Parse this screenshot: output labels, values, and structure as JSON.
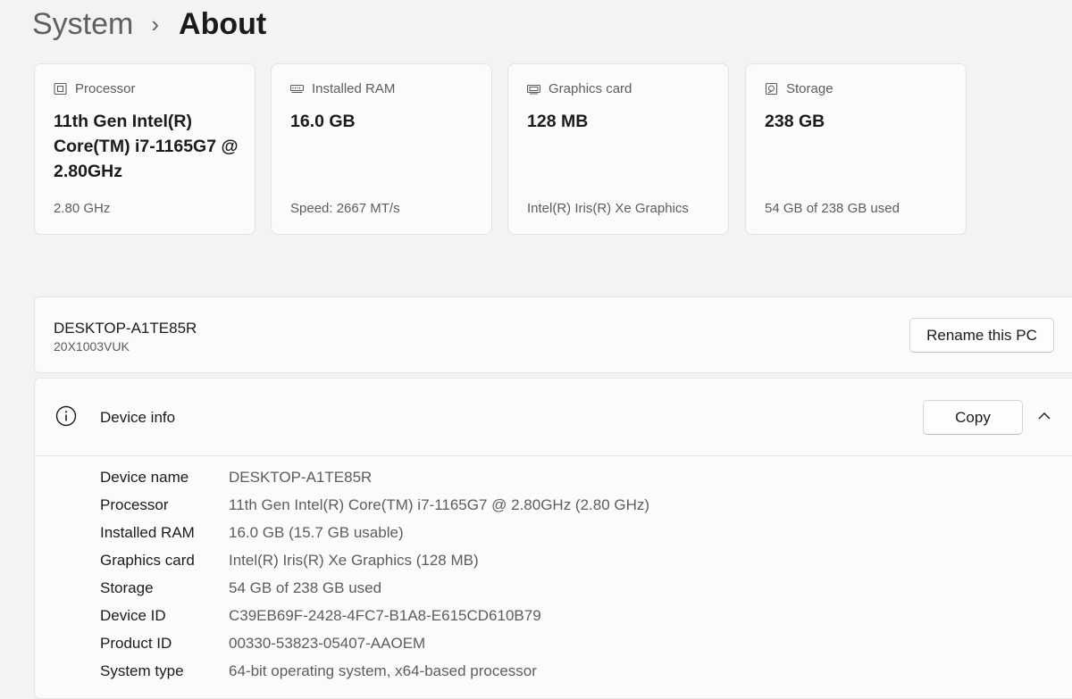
{
  "breadcrumb": {
    "parent": "System",
    "separator": "›",
    "current": "About"
  },
  "cards": [
    {
      "icon": "processor-icon",
      "label": "Processor",
      "value": "11th Gen Intel(R) Core(TM) i7-1165G7 @ 2.80GHz",
      "sub": "2.80 GHz"
    },
    {
      "icon": "ram-icon",
      "label": "Installed RAM",
      "value": "16.0 GB",
      "sub": "Speed: 2667 MT/s"
    },
    {
      "icon": "graphics-card-icon",
      "label": "Graphics card",
      "value": "128 MB",
      "sub": "Intel(R) Iris(R) Xe Graphics"
    },
    {
      "icon": "storage-icon",
      "label": "Storage",
      "value": "238 GB",
      "sub": "54 GB of 238 GB used"
    }
  ],
  "pc": {
    "name": "DESKTOP-A1TE85R",
    "model": "20X1003VUK",
    "rename_label": "Rename this PC"
  },
  "device_info": {
    "title": "Device info",
    "copy_label": "Copy",
    "rows": [
      {
        "label": "Device name",
        "value": "DESKTOP-A1TE85R"
      },
      {
        "label": "Processor",
        "value": "11th Gen Intel(R) Core(TM) i7-1165G7 @ 2.80GHz (2.80 GHz)"
      },
      {
        "label": "Installed RAM",
        "value": "16.0 GB (15.7 GB usable)"
      },
      {
        "label": "Graphics card",
        "value": "Intel(R) Iris(R) Xe Graphics (128 MB)"
      },
      {
        "label": "Storage",
        "value": "54 GB of 238 GB used"
      },
      {
        "label": "Device ID",
        "value": "C39EB69F-2428-4FC7-B1A8-E615CD610B79"
      },
      {
        "label": "Product ID",
        "value": "00330-53823-05407-AAOEM"
      },
      {
        "label": "System type",
        "value": "64-bit operating system, x64-based processor"
      }
    ]
  },
  "colors": {
    "background": "#f3f3f3",
    "card": "#fbfbfb",
    "secondary_text": "#5d5d5d"
  }
}
